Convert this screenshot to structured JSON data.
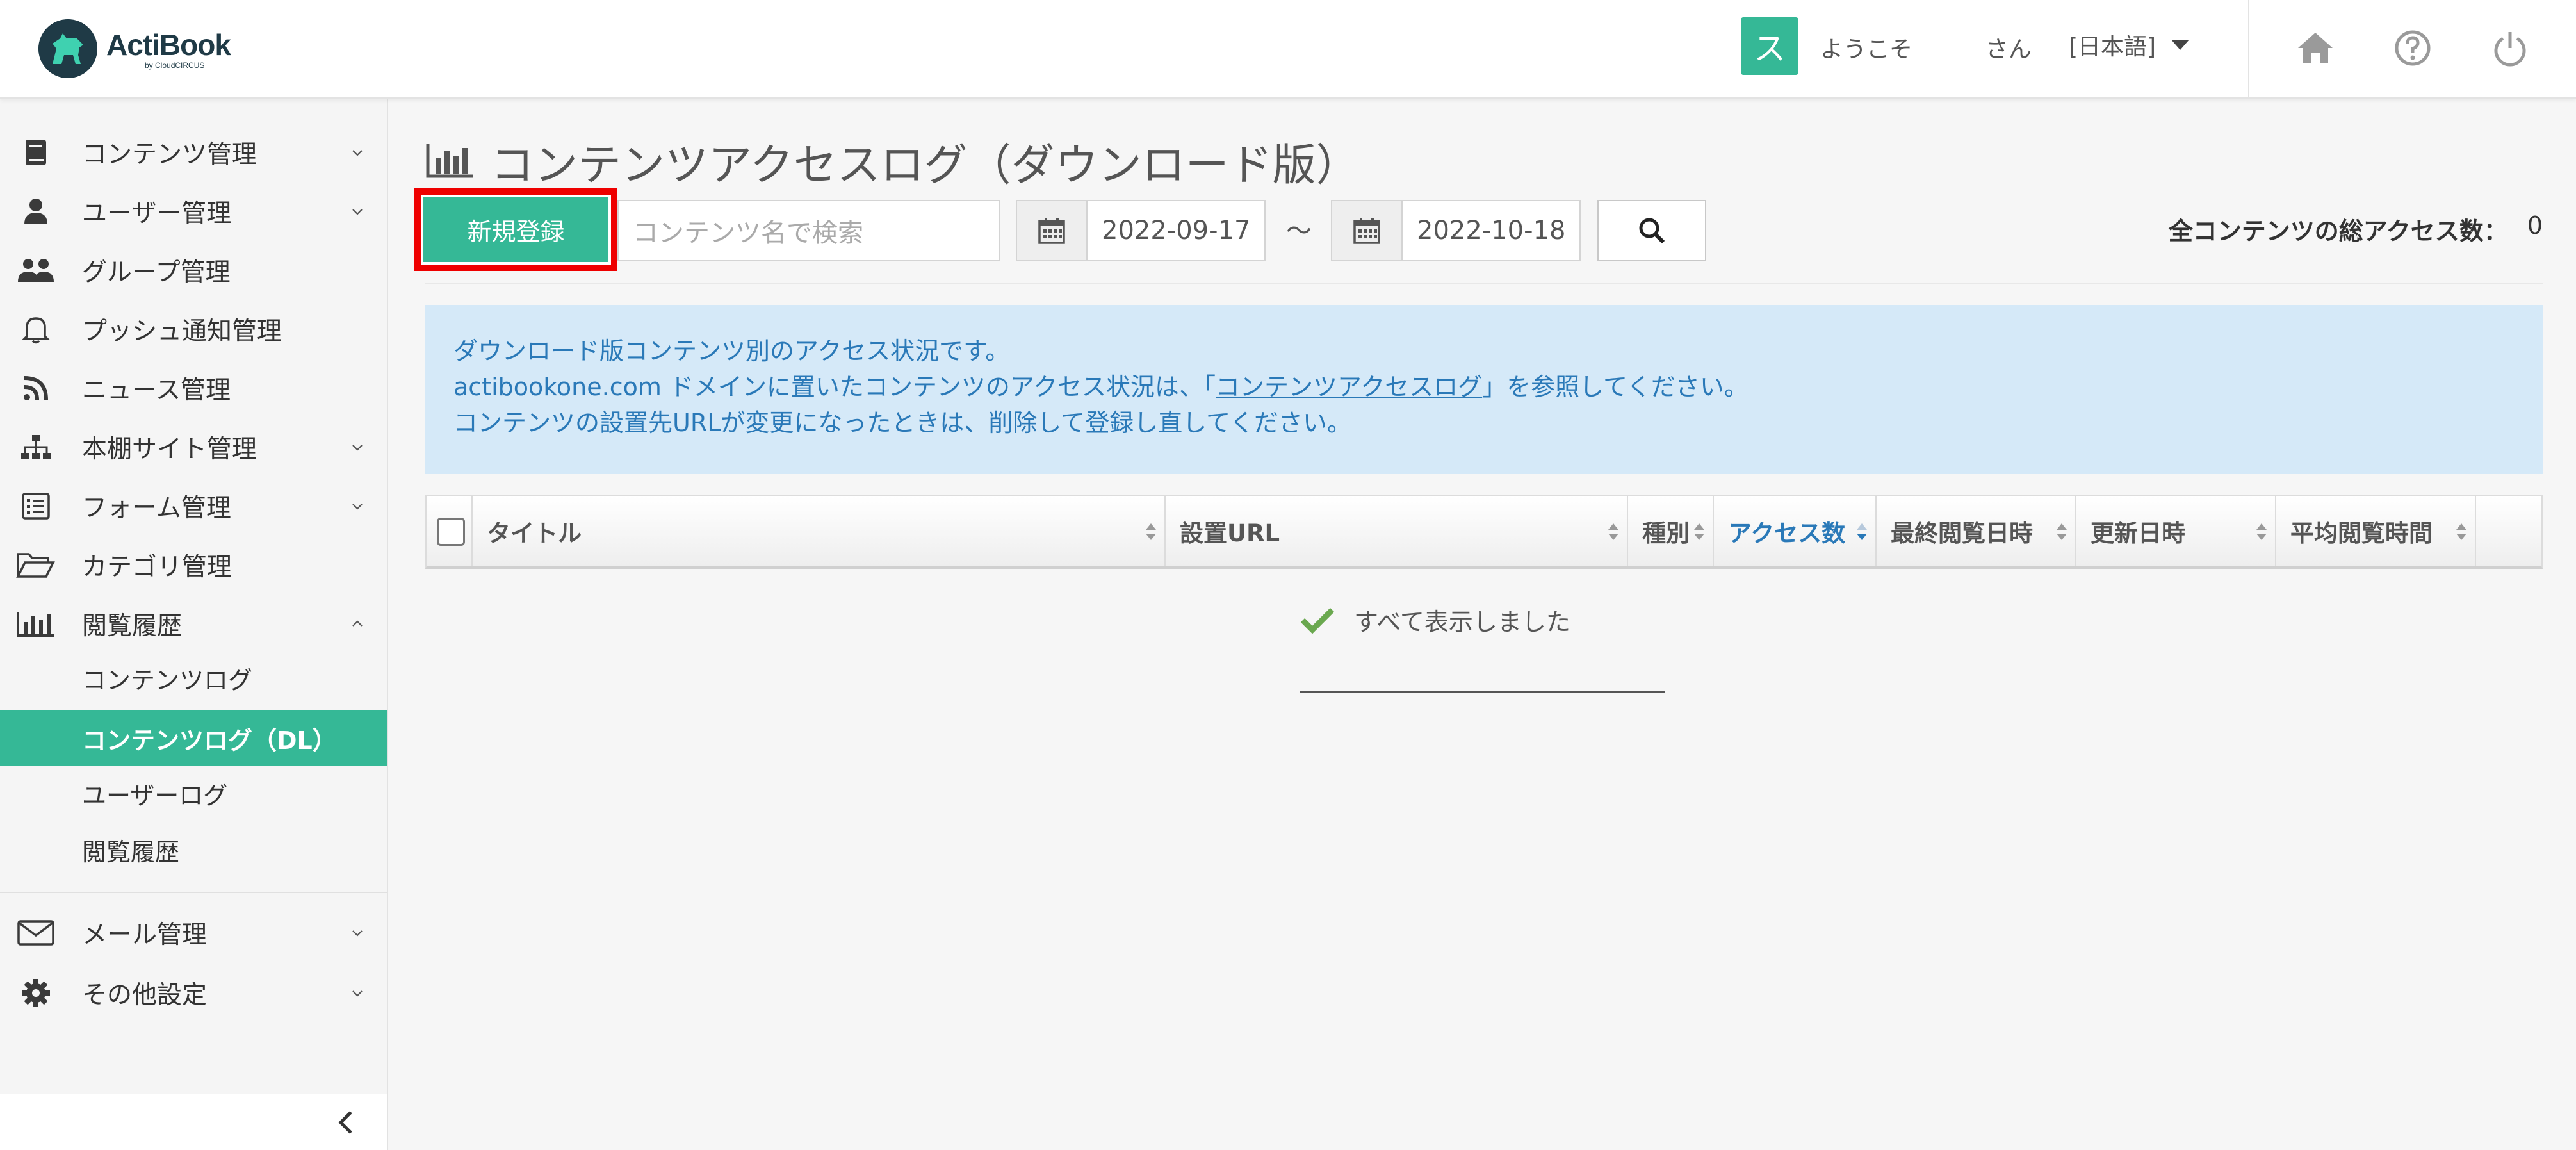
{
  "header": {
    "logo_name": "ActiBook",
    "logo_sub": "by CloudCIRCUS",
    "avatar_initial": "ス",
    "welcome": "ようこそ",
    "san": "さん",
    "language": "[日本語]",
    "icons": [
      "home-icon",
      "help-icon",
      "power-icon"
    ]
  },
  "sidebar": {
    "items": [
      {
        "label": "コンテンツ管理",
        "icon": "book-icon"
      },
      {
        "label": "ユーザー管理",
        "icon": "user-icon"
      },
      {
        "label": "グループ管理",
        "icon": "users-icon"
      },
      {
        "label": "プッシュ通知管理",
        "icon": "bell-icon"
      },
      {
        "label": "ニュース管理",
        "icon": "rss-icon"
      },
      {
        "label": "本棚サイト管理",
        "icon": "sitemap-icon"
      },
      {
        "label": "フォーム管理",
        "icon": "form-icon"
      },
      {
        "label": "カテゴリ管理",
        "icon": "folder-icon"
      },
      {
        "label": "閲覧履歴",
        "icon": "bar-chart-icon"
      }
    ],
    "subitems": [
      {
        "label": "コンテンツログ"
      },
      {
        "label": "コンテンツログ（DL）"
      },
      {
        "label": "ユーザーログ"
      },
      {
        "label": "閲覧履歴"
      }
    ],
    "bottom_items": [
      {
        "label": "メール管理",
        "icon": "mail-icon"
      },
      {
        "label": "その他設定",
        "icon": "gear-icon"
      }
    ]
  },
  "main": {
    "title": "コンテンツアクセスログ（ダウンロード版）",
    "new_button": "新規登録",
    "search_placeholder": "コンテンツ名で検索",
    "date_from": "2022-09-17",
    "date_sep": "～",
    "date_to": "2022-10-18",
    "total_label": "全コンテンツの総アクセス数：",
    "total_value": "0",
    "notice": {
      "line1": "ダウンロード版コンテンツ別のアクセス状況です。",
      "line2_pre": "actibookone.com ドメインに置いたコンテンツのアクセス状況は、「",
      "line2_link": "コンテンツアクセスログ",
      "line2_post": "」を参照してください。",
      "line3": "コンテンツの設置先URLが変更になったときは、削除して登録し直してください。"
    },
    "table": {
      "columns": [
        "タイトル",
        "設置URL",
        "種別",
        "アクセス数",
        "最終閲覧日時",
        "更新日時",
        "平均閲覧時間"
      ],
      "sorted_column": "アクセス数"
    },
    "all_shown": "すべて表示しました"
  },
  "colors": {
    "accent": "#35b896",
    "notice_bg": "#d5e9f8",
    "notice_text": "#2a79b8",
    "highlight_border": "#ee0000"
  }
}
